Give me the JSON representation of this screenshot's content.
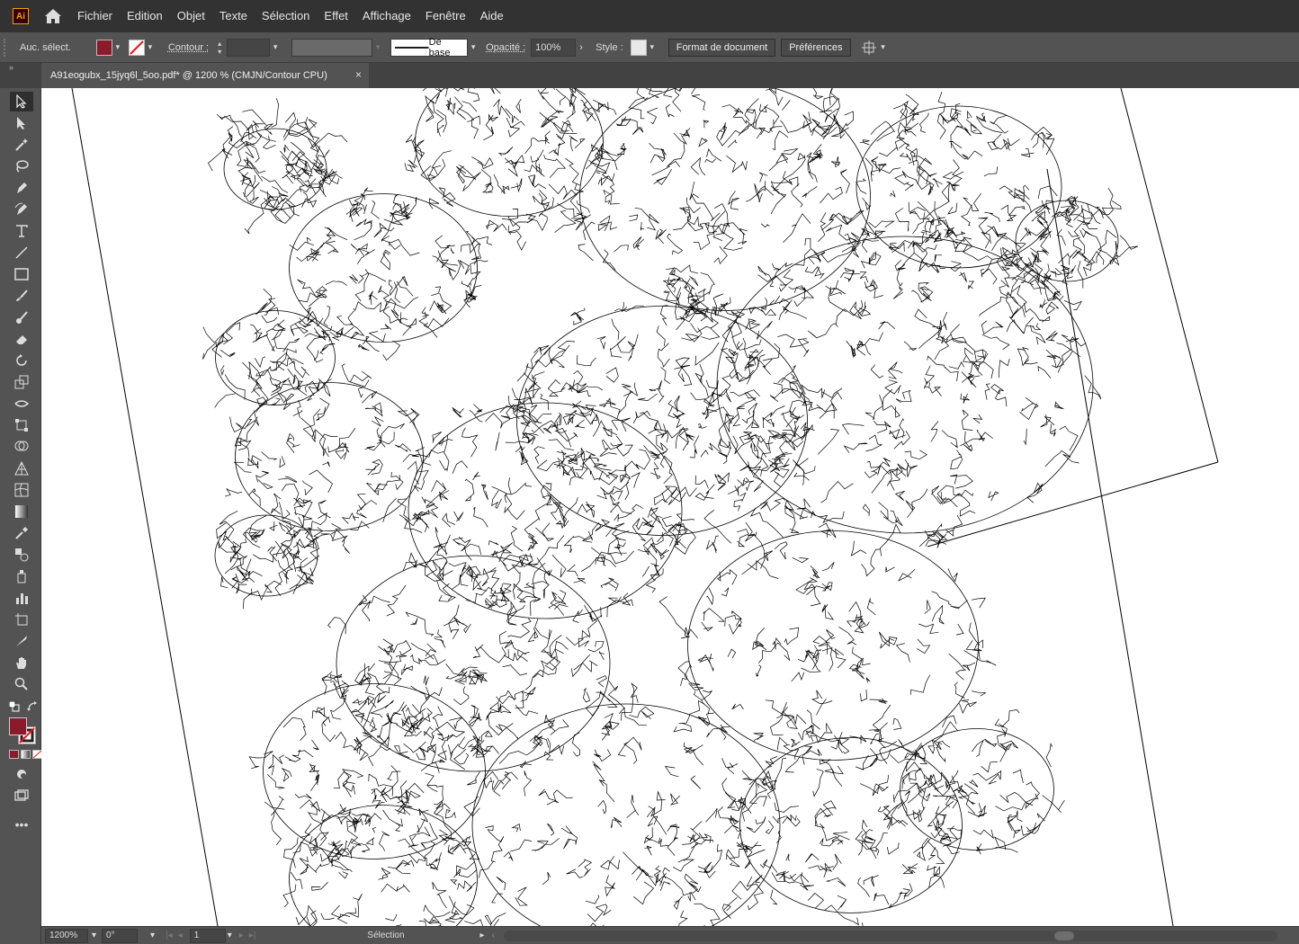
{
  "app": {
    "logo": "Ai"
  },
  "menu": [
    "Fichier",
    "Edition",
    "Objet",
    "Texte",
    "Sélection",
    "Effet",
    "Affichage",
    "Fenêtre",
    "Aide"
  ],
  "control": {
    "selection_status": "Auc. sélect.",
    "fill_color": "#8b1a2a",
    "stroke_label": "Contour :",
    "brush_label": "De base",
    "opacity_label": "Opacité :",
    "opacity_value": "100%",
    "style_label": "Style :",
    "doc_format_button": "Format de document",
    "preferences_button": "Préférences"
  },
  "tab": {
    "title": "A91eogubx_15jyq6l_5oo.pdf* @ 1200 % (CMJN/Contour CPU)",
    "close": "×"
  },
  "tools": [
    "selection-tool",
    "direct-selection-tool",
    "magic-wand-tool",
    "lasso-tool",
    "pen-tool",
    "curvature-tool",
    "type-tool",
    "line-tool",
    "rectangle-tool",
    "paintbrush-tool",
    "shaper-tool",
    "eraser-tool",
    "rotate-tool",
    "scale-tool",
    "warp-tool",
    "free-transform-tool",
    "shape-builder-tool",
    "perspective-grid-tool",
    "mesh-tool",
    "gradient-tool",
    "eyedropper-tool",
    "blend-tool",
    "symbol-sprayer-tool",
    "column-graph-tool",
    "artboard-tool",
    "slice-tool",
    "hand-tool",
    "zoom-tool"
  ],
  "status": {
    "zoom": "1200%",
    "rotation": "0°",
    "artboard": "1",
    "current_tool": "Sélection"
  },
  "colors": {
    "fill": "#8b1a2a",
    "accent": "#ff9a00"
  }
}
